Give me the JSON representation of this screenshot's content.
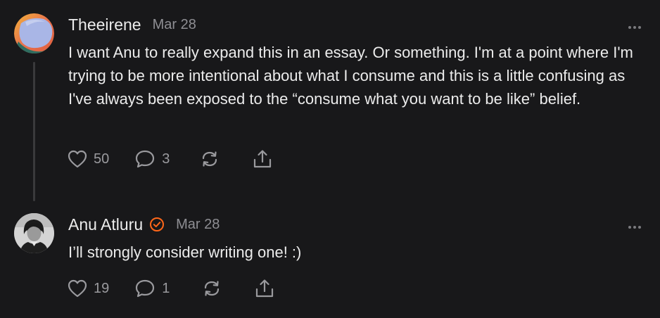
{
  "comments": [
    {
      "author": "Theeirene",
      "date": "Mar 28",
      "verified": false,
      "avatar": "gradient-blob-avatar",
      "text": "I want Anu to really expand this in an essay. Or something. I'm at a point where I'm trying to be more intentional about what I consume and this is a little confusing as I've always been exposed to the “consume what you want to be like” belief.",
      "likes": "50",
      "replies": "3",
      "icons": [
        "heart-icon",
        "comment-icon",
        "restack-icon",
        "share-icon",
        "more-icon"
      ]
    },
    {
      "author": "Anu Atluru",
      "date": "Mar 28",
      "verified": true,
      "avatar": "photo-avatar",
      "text": "I’ll strongly consider writing one! :)",
      "likes": "19",
      "replies": "1",
      "icons": [
        "heart-icon",
        "comment-icon",
        "restack-icon",
        "share-icon",
        "more-icon"
      ]
    }
  ],
  "colors": {
    "background": "#18181a",
    "text": "#ececec",
    "muted": "#8e8e93",
    "thread_line": "#3a3a3c",
    "verified_accent": "#ff6719"
  }
}
